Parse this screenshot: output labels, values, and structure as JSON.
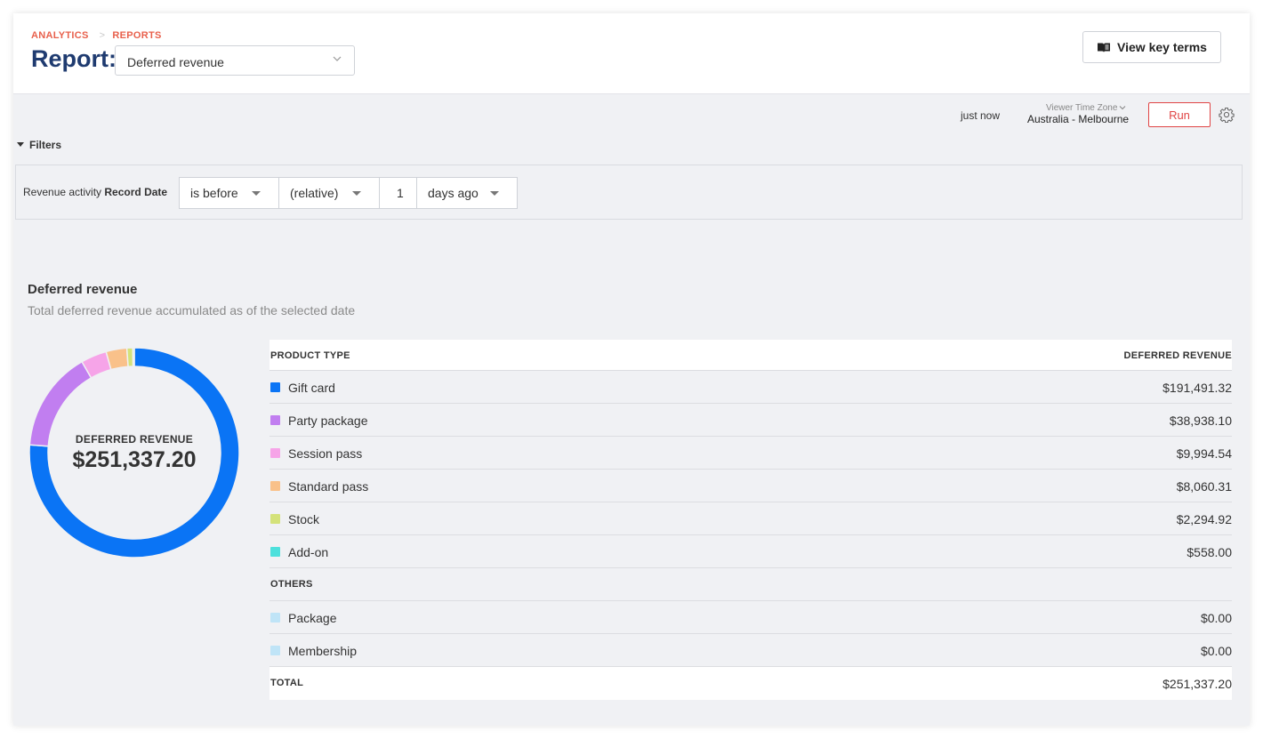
{
  "breadcrumb": {
    "first": "ANALYTICS",
    "second": "REPORTS"
  },
  "page": {
    "title_label": "Report:",
    "selected_report": "Deferred revenue"
  },
  "actions": {
    "view_key_terms": "View key terms",
    "run": "Run"
  },
  "toolbar": {
    "last_run": "just now",
    "timezone_label": "Viewer Time Zone",
    "timezone_value": "Australia - Melbourne"
  },
  "filters": {
    "toggle_label": "Filters",
    "label_prefix": "Revenue activity",
    "label_field": "Record Date",
    "operator": "is before",
    "mode": "(relative)",
    "amount": "1",
    "unit": "days ago"
  },
  "section": {
    "title": "Deferred revenue",
    "subtitle": "Total deferred revenue accumulated as of the selected date"
  },
  "chart_data": {
    "type": "pie",
    "center_label": "DEFERRED REVENUE",
    "center_value": "$251,337.20",
    "slices": [
      {
        "label": "Gift card",
        "value": 191491.32,
        "color": "#0a74f5"
      },
      {
        "label": "Party package",
        "value": 38938.1,
        "color": "#c17ef0"
      },
      {
        "label": "Session pass",
        "value": 9994.54,
        "color": "#f6a4e8"
      },
      {
        "label": "Standard pass",
        "value": 8060.31,
        "color": "#f9c18a"
      },
      {
        "label": "Stock",
        "value": 2294.92,
        "color": "#d4e27a"
      },
      {
        "label": "Add-on",
        "value": 558.0,
        "color": "#4de0dc"
      }
    ]
  },
  "table": {
    "col_type": "PRODUCT TYPE",
    "col_revenue": "DEFERRED REVENUE",
    "rows": [
      {
        "name": "Gift card",
        "amount": "$191,491.32",
        "color": "#0a74f5"
      },
      {
        "name": "Party package",
        "amount": "$38,938.10",
        "color": "#c17ef0"
      },
      {
        "name": "Session pass",
        "amount": "$9,994.54",
        "color": "#f6a4e8"
      },
      {
        "name": "Standard pass",
        "amount": "$8,060.31",
        "color": "#f9c18a"
      },
      {
        "name": "Stock",
        "amount": "$2,294.92",
        "color": "#d4e27a"
      },
      {
        "name": "Add-on",
        "amount": "$558.00",
        "color": "#4de0dc"
      }
    ],
    "others_label": "OTHERS",
    "others": [
      {
        "name": "Package",
        "amount": "$0.00",
        "color": "#bfe4f7"
      },
      {
        "name": "Membership",
        "amount": "$0.00",
        "color": "#bfe4f7"
      }
    ],
    "total_label": "TOTAL",
    "total_amount": "$251,337.20"
  }
}
